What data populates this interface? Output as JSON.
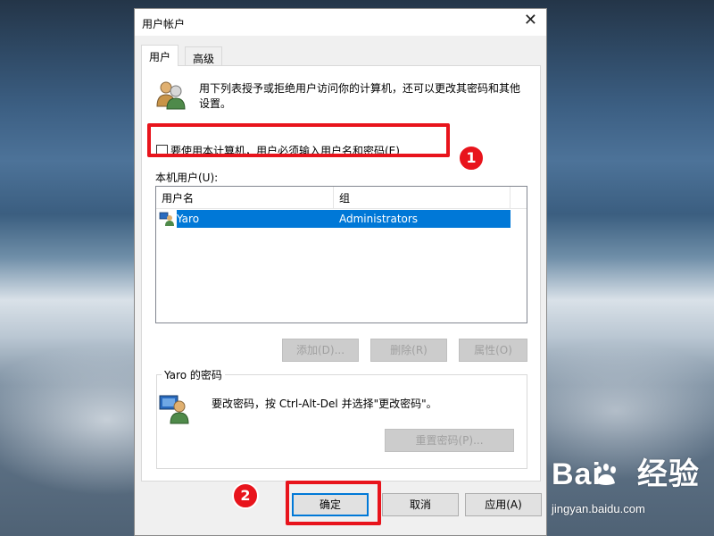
{
  "window": {
    "title": "用户帐户"
  },
  "tabs": [
    {
      "label": "用户"
    },
    {
      "label": "高级"
    }
  ],
  "description": "用下列表授予或拒绝用户访问你的计算机，还可以更改其密码和其他设置。",
  "checkbox": {
    "label": "要使用本计算机，用户必须输入用户名和密码(E)",
    "checked": false
  },
  "users_label": "本机用户(U):",
  "table": {
    "headers": [
      "用户名",
      "组"
    ],
    "rows": [
      {
        "name": "Yaro",
        "group": "Administrators",
        "selected": true
      }
    ]
  },
  "buttons": {
    "add": "添加(D)...",
    "remove": "删除(R)",
    "properties": "属性(O)"
  },
  "password_section": {
    "title": "Yaro 的密码",
    "text": "要改密码，按 Ctrl-Alt-Del 并选择\"更改密码\"。",
    "reset_button": "重置密码(P)..."
  },
  "footer": {
    "ok": "确定",
    "cancel": "取消",
    "apply": "应用(A)"
  },
  "annotations": {
    "badge1": "1",
    "badge2": "2",
    "accent_color": "#e8141c"
  },
  "watermark": {
    "main": "Bai",
    "main2": "经验",
    "sub": "jingyan.baidu.com"
  }
}
